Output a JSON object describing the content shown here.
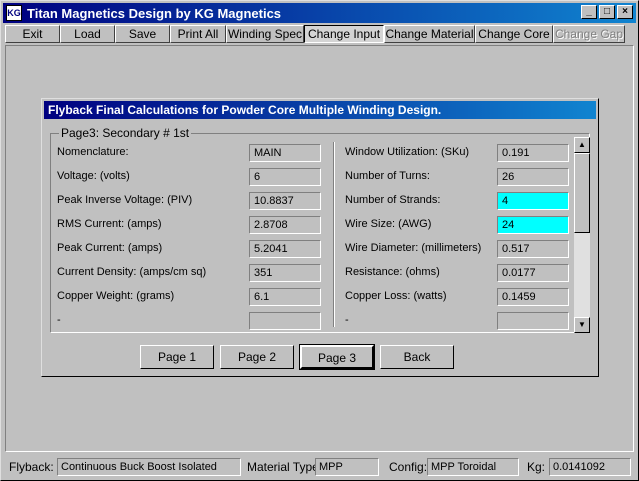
{
  "window": {
    "icon_text": "KG",
    "title": "Titan Magnetics Design by KG Magnetics",
    "minimize": "_",
    "maximize": "□",
    "close": "×"
  },
  "toolbar": {
    "exit": "Exit",
    "load": "Load",
    "save": "Save",
    "print_all": "Print All",
    "winding_spec": "Winding Spec",
    "change_input": "Change Input",
    "change_material": "Change Material",
    "change_core": "Change Core",
    "change_gap": "Change Gap"
  },
  "dialog": {
    "title": "Flyback Final Calculations for Powder Core Multiple Winding Design.",
    "group_label": "Page3: Secondary # 1st",
    "left": [
      {
        "label": "Nomenclature:",
        "value": "MAIN"
      },
      {
        "label": "Voltage: (volts)",
        "value": "6"
      },
      {
        "label": "Peak Inverse Voltage: (PIV)",
        "value": "10.8837"
      },
      {
        "label": "RMS Current: (amps)",
        "value": "2.8708"
      },
      {
        "label": "Peak Current: (amps)",
        "value": "5.2041"
      },
      {
        "label": "Current Density: (amps/cm sq)",
        "value": "351"
      },
      {
        "label": "Copper Weight: (grams)",
        "value": "6.1"
      },
      {
        "label": "-",
        "value": ""
      }
    ],
    "right": [
      {
        "label": "Window Utilization: (SKu)",
        "value": "0.191"
      },
      {
        "label": "Number of Turns:",
        "value": "26"
      },
      {
        "label": "Number of Strands:",
        "value": "4"
      },
      {
        "label": "Wire Size: (AWG)",
        "value": "24"
      },
      {
        "label": "Wire Diameter: (millimeters)",
        "value": "0.517"
      },
      {
        "label": "Resistance: (ohms)",
        "value": "0.0177"
      },
      {
        "label": "Copper Loss: (watts)",
        "value": "0.1459"
      },
      {
        "label": "-",
        "value": ""
      }
    ],
    "buttons": {
      "page1": "Page 1",
      "page2": "Page 2",
      "page3": "Page 3",
      "back": "Back"
    },
    "scroll_up": "▲",
    "scroll_down": "▼",
    "highlight_color": "#00ffff"
  },
  "status": {
    "flyback_label": "Flyback:",
    "flyback_value": "Continuous Buck Boost Isolated",
    "material_label": "Material Type:",
    "material_value": "MPP",
    "config_label": "Config:",
    "config_value": "MPP Toroidal",
    "kg_label": "Kg:",
    "kg_value": "0.0141092"
  }
}
